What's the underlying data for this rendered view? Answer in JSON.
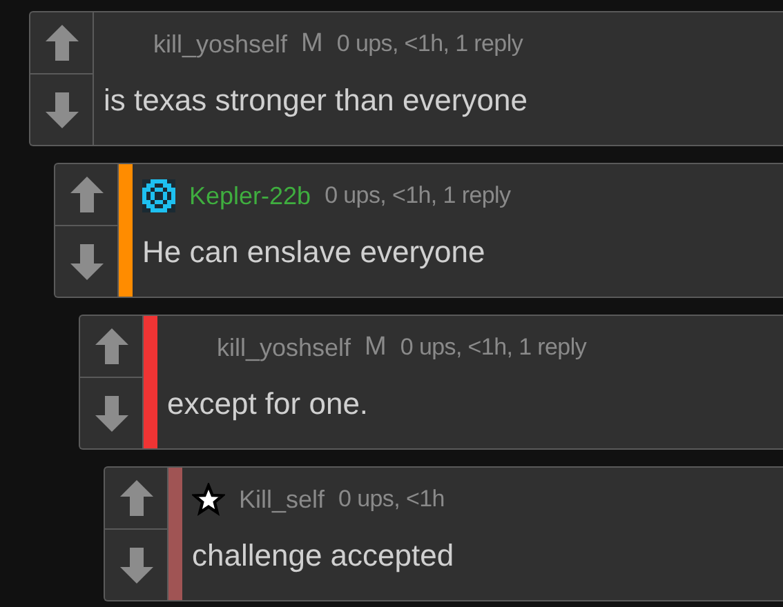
{
  "comments": [
    {
      "user": {
        "name": "kill_yoshself",
        "color": "#8a8a8a",
        "kind": "plain"
      },
      "badge": "M",
      "meta": "0 ups, <1h, 1 reply",
      "text": "is texas stronger than everyone",
      "children": [
        {
          "user": {
            "name": "Kepler-22b",
            "color": "#3fae3f",
            "kind": "pixel"
          },
          "meta": "0 ups, <1h, 1 reply",
          "text": "He can enslave everyone",
          "depth_bar": {
            "color": "#ff8c00"
          },
          "children": [
            {
              "user": {
                "name": "kill_yoshself",
                "color": "#8a8a8a",
                "kind": "plain"
              },
              "badge": "M",
              "meta": "0 ups, <1h, 1 reply",
              "text": "except for one.",
              "depth_bar": {
                "color": "#ef3434"
              },
              "children": [
                {
                  "user": {
                    "name": "Kill_self",
                    "color": "#8a8a8a",
                    "kind": "star"
                  },
                  "meta": "0 ups, <1h",
                  "text": "challenge accepted",
                  "depth_bar": {
                    "color": "#a05454"
                  }
                }
              ]
            }
          ]
        }
      ]
    }
  ]
}
